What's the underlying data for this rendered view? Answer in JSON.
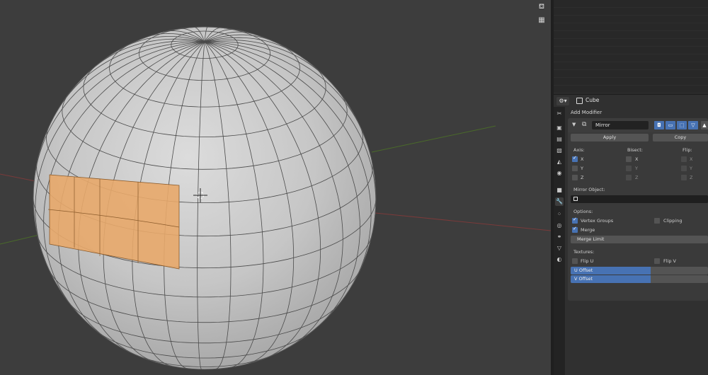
{
  "viewport": {
    "icons": [
      "camera-icon",
      "grid-icon"
    ]
  },
  "properties": {
    "object_name": "Cube",
    "add_modifier_label": "Add Modifier",
    "modifier": {
      "name": "Mirror",
      "apply_label": "Apply",
      "copy_label": "Copy",
      "axis_header": "Axis:",
      "bisect_header": "Bisect:",
      "flip_header": "Flip:",
      "axis": [
        {
          "label": "X",
          "checked": true
        },
        {
          "label": "Y",
          "checked": false
        },
        {
          "label": "Z",
          "checked": false
        }
      ],
      "bisect": [
        {
          "label": "X"
        },
        {
          "label": "Y"
        },
        {
          "label": "Z"
        }
      ],
      "flip": [
        {
          "label": "X"
        },
        {
          "label": "Y"
        },
        {
          "label": "Z"
        }
      ],
      "mirror_object_label": "Mirror Object:",
      "options_label": "Options:",
      "vertex_groups_label": "Vertex Groups",
      "vertex_groups_checked": true,
      "clipping_label": "Clipping",
      "clipping_checked": false,
      "merge_label": "Merge",
      "merge_checked": true,
      "merge_limit_label": "Merge Limit",
      "textures_label": "Textures:",
      "flip_u_label": "Flip U",
      "flip_v_label": "Flip V",
      "u_offset_label": "U Offset",
      "v_offset_label": "V Offset",
      "u_offset_fill": 0.58,
      "v_offset_fill": 0.58
    }
  },
  "colors": {
    "selection": "#e8a86a",
    "accent": "#4772b3",
    "mesh": "#c8c8c8"
  }
}
